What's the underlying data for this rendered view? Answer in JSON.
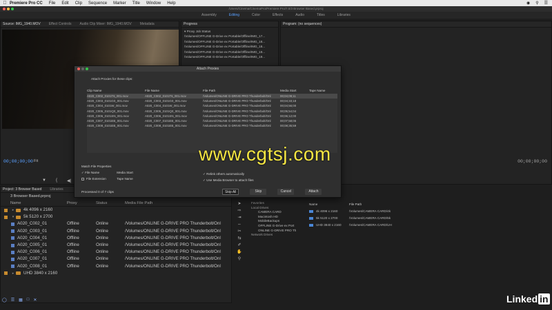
{
  "menubar": {
    "app": "Premiere Pro CC",
    "items": [
      "File",
      "Edit",
      "Clip",
      "Sequence",
      "Marker",
      "Title",
      "Window",
      "Help"
    ]
  },
  "window": {
    "title": "/Users/Cinema/CinemaPro/Premiere Pro/7.0/3 Browser Based.prproj"
  },
  "workspaces": [
    "Assembly",
    "Editing",
    "Color",
    "Effects",
    "Audio",
    "Titles",
    "Libraries"
  ],
  "source": {
    "tabs": [
      "Source: IMG_1940.MOV",
      "Effect Controls",
      "Audio Clip Mixer: IMG_1940.MOV",
      "Metadata"
    ],
    "timecode": "00;00;00;00",
    "fit": "Fit"
  },
  "progress": {
    "tab": "Progress",
    "section": "Proxy Job Status",
    "jobs": [
      "/Volumes/OFFLINE G-Drive ex Portable/Offline/IMG_17...",
      "/Volumes/OFFLINE G-Drive ex Portable/Offline/IMG_18...",
      "/Volumes/OFFLINE G-Drive ex Portable/Offline/IMG_18...",
      "/Volumes/OFFLINE G-Drive ex Portable/Offline/IMG_19...",
      "/Volumes/OFFLINE G-Drive ex Portable/Offline/IMG_19..."
    ]
  },
  "program": {
    "tab": "Program: (no sequences)",
    "timecode": "00;00;00;00"
  },
  "dialog": {
    "title": "Attach Proxies",
    "subtitle": "Attach Proxies for these clips:",
    "columns": [
      "Clip Name",
      "File Name",
      "File Path",
      "Media Start",
      "Tape Name"
    ],
    "rows": [
      [
        "A020_C002_0101T6_001.mov",
        "A020_C002_0101T6_001.mov",
        "/Volumes/ONLINE G-DRIVE PRO Thunderbolt/Onl",
        "00;04;09;11",
        ""
      ],
      [
        "A020_C003_0101G0_001.mov",
        "A020_C003_0101G0_001.mov",
        "/Volumes/ONLINE G-DRIVE PRO Thunderbolt/Onl",
        "00;04;33;18",
        ""
      ],
      [
        "A020_C004_0101W_001.mov",
        "A020_C004_0101W_001.mov",
        "/Volumes/ONLINE G-DRIVE PRO Thunderbolt/Onl",
        "00;04;56;00",
        ""
      ],
      [
        "A020_C005_0101Q0_001.mov",
        "A020_C005_0101Q0_001.mov",
        "/Volumes/ONLINE G-DRIVE PRO Thunderbolt/Onl",
        "00;05;54;04",
        ""
      ],
      [
        "A020_C006_0101SN_001.mov",
        "A020_C006_0101SN_001.mov",
        "/Volumes/ONLINE G-DRIVE PRO Thunderbolt/Onl",
        "00;06;12;00",
        ""
      ],
      [
        "A020_C007_0101EB_001.mov",
        "A020_C007_0101EB_001.mov",
        "/Volumes/ONLINE G-DRIVE PRO Thunderbolt/Onl",
        "00;07;58;06",
        ""
      ],
      [
        "A020_C008_0101EB_001.mov",
        "A020_C008_0101EB_001.mov",
        "/Volumes/ONLINE G-DRIVE PRO Thunderbolt/Onl",
        "00;08;35;59",
        ""
      ]
    ],
    "match_title": "Match File Properties",
    "match_options": [
      "File Name",
      "Media Start",
      "File Extension",
      "Tape Name"
    ],
    "relink_others": "Relink others automatically",
    "use_media_browser": "Use Media Browser to attach files",
    "status": "Processed 0 of 7 clips",
    "buttons": {
      "skip_all": "Skip All",
      "skip": "Skip",
      "cancel": "Cancel",
      "attach": "Attach"
    }
  },
  "watermark": "www.cgtsj.com",
  "project": {
    "tabs": [
      "Project: 3 Browser Based",
      "Libraries"
    ],
    "name": "3 Browser Based.prproj",
    "columns": [
      "Name",
      "Proxy",
      "Status",
      "Media File Path"
    ],
    "rows": [
      {
        "type": "folder",
        "name": "4k 4096 x 2160",
        "proxy": "",
        "status": "",
        "path": "",
        "expanded": false,
        "label": "#c88b2e"
      },
      {
        "type": "folder",
        "name": "5k 5120 x 2700",
        "proxy": "",
        "status": "",
        "path": "",
        "expanded": true,
        "label": "#c88b2e"
      },
      {
        "type": "clip",
        "name": "A020_C002_01",
        "proxy": "Offline",
        "status": "Online",
        "path": "/Volumes/ONLINE G-DRIVE PRO Thunderbolt/Onl",
        "label": "#5a7fc4"
      },
      {
        "type": "clip",
        "name": "A020_C003_01",
        "proxy": "Offline",
        "status": "Online",
        "path": "/Volumes/ONLINE G-DRIVE PRO Thunderbolt/Onl",
        "label": "#5a7fc4"
      },
      {
        "type": "clip",
        "name": "A020_C004_01",
        "proxy": "Offline",
        "status": "Online",
        "path": "/Volumes/ONLINE G-DRIVE PRO Thunderbolt/Onl",
        "label": "#5a7fc4"
      },
      {
        "type": "clip",
        "name": "A020_C005_01",
        "proxy": "Offline",
        "status": "Online",
        "path": "/Volumes/ONLINE G-DRIVE PRO Thunderbolt/Onl",
        "label": "#5a7fc4"
      },
      {
        "type": "clip",
        "name": "A020_C006_01",
        "proxy": "Offline",
        "status": "Online",
        "path": "/Volumes/ONLINE G-DRIVE PRO Thunderbolt/Onl",
        "label": "#5a7fc4"
      },
      {
        "type": "clip",
        "name": "A020_C007_01",
        "proxy": "Offline",
        "status": "Online",
        "path": "/Volumes/ONLINE G-DRIVE PRO Thunderbolt/Onl",
        "label": "#5a7fc4"
      },
      {
        "type": "clip",
        "name": "A020_C008_01",
        "proxy": "Offline",
        "status": "Online",
        "path": "/Volumes/ONLINE G-DRIVE PRO Thunderbolt/Onl",
        "label": "#5a7fc4"
      },
      {
        "type": "folder",
        "name": "UHD 3840 x 2160",
        "proxy": "",
        "status": "",
        "path": "",
        "expanded": false,
        "label": "#c88b2e"
      }
    ]
  },
  "media_browser": {
    "favorites": "Favorites",
    "local_drives": "Local Drives",
    "drives": [
      "CAMERA CARD",
      "Macintosh HD",
      "MobileBackups",
      "OFFLINE G-Drive ex Port",
      "ONLINE G-DRIVE PRO Th"
    ],
    "network_drives": "Network Drives",
    "columns": [
      "Name",
      "File Path"
    ],
    "rows": [
      {
        "name": "4k 4096 x 2160",
        "path": "/Volumes/CAMERA CARD/4k"
      },
      {
        "name": "5k 5120 x 2700",
        "path": "/Volumes/CAMERA CARD/5k"
      },
      {
        "name": "UHD 3840 x 2160",
        "path": "/Volumes/CAMERA CARD/UH"
      }
    ]
  },
  "branding": {
    "linkedin": "Linked",
    "in": "in"
  },
  "colors": {
    "accent": "#5aa0ff",
    "watermark": "#f4e542",
    "folder": "#c88b2e"
  }
}
